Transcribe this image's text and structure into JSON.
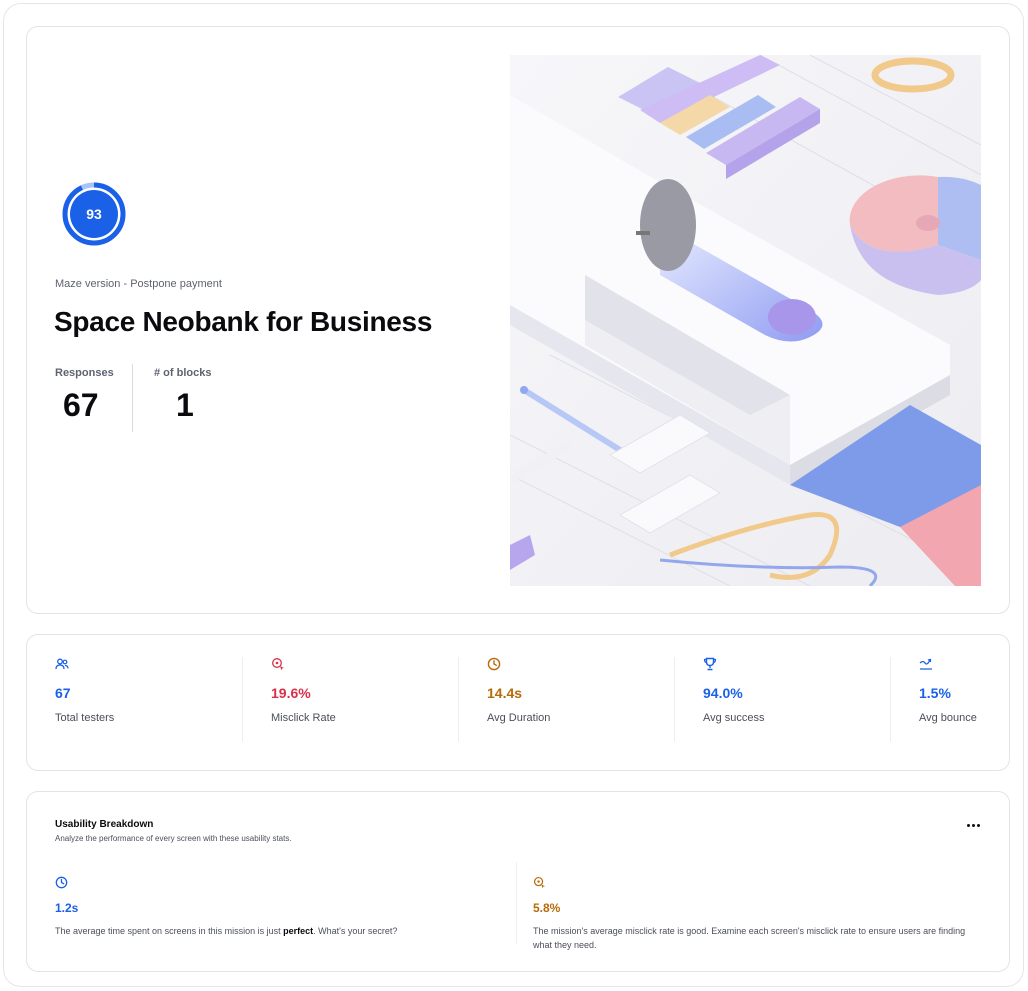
{
  "hero": {
    "score": "93",
    "score_fraction": 0.93,
    "eyebrow": "Maze version - Postpone payment",
    "title": "Space Neobank for Business",
    "metrics": [
      {
        "label": "Responses",
        "value": "67"
      },
      {
        "label": "# of blocks",
        "value": "1"
      }
    ]
  },
  "stats": [
    {
      "icon": "users-icon",
      "value": "67",
      "label": "Total testers",
      "color": "#1a61e8"
    },
    {
      "icon": "misclick-icon",
      "value": "19.6%",
      "label": "Misclick Rate",
      "color": "#d9304a"
    },
    {
      "icon": "clock-icon",
      "value": "14.4s",
      "label": "Avg Duration",
      "color": "#b86a0a"
    },
    {
      "icon": "trophy-icon",
      "value": "94.0%",
      "label": "Avg success",
      "color": "#1a61e8"
    },
    {
      "icon": "bounce-icon",
      "value": "1.5%",
      "label": "Avg bounce",
      "color": "#1a61e8"
    }
  ],
  "breakdown": {
    "title": "Usability Breakdown",
    "subtitle": "Analyze the performance of every screen with these usability stats.",
    "items": [
      {
        "icon": "clock-icon",
        "value": "1.2s",
        "text_before": "The average time spent on screens in this mission is just ",
        "text_bold": "perfect",
        "text_after": ". What's your secret?",
        "color": "#1a61e8"
      },
      {
        "icon": "misclick-icon",
        "value": "5.8%",
        "text": "The mission's average misclick rate is good. Examine each screen's misclick rate to ensure users are finding what they need.",
        "color": "#b86a0a"
      }
    ]
  },
  "colors": {
    "primary": "#1a61e8",
    "ring_track": "#a8c4f5",
    "danger": "#d9304a",
    "warning": "#b86a0a"
  }
}
